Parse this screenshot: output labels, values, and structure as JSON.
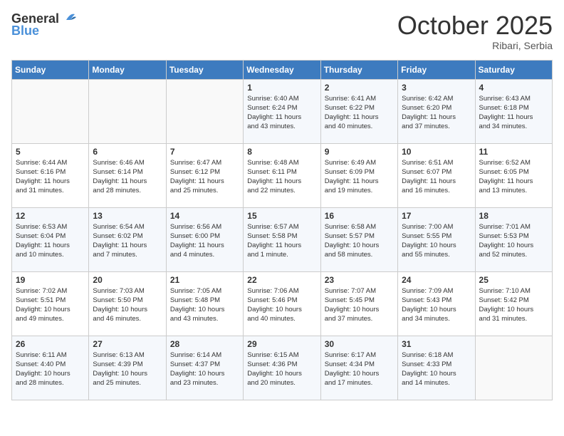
{
  "header": {
    "logo_general": "General",
    "logo_blue": "Blue",
    "month_title": "October 2025",
    "location": "Ribari, Serbia"
  },
  "days_of_week": [
    "Sunday",
    "Monday",
    "Tuesday",
    "Wednesday",
    "Thursday",
    "Friday",
    "Saturday"
  ],
  "weeks": [
    [
      {
        "day": "",
        "info": ""
      },
      {
        "day": "",
        "info": ""
      },
      {
        "day": "",
        "info": ""
      },
      {
        "day": "1",
        "info": "Sunrise: 6:40 AM\nSunset: 6:24 PM\nDaylight: 11 hours\nand 43 minutes."
      },
      {
        "day": "2",
        "info": "Sunrise: 6:41 AM\nSunset: 6:22 PM\nDaylight: 11 hours\nand 40 minutes."
      },
      {
        "day": "3",
        "info": "Sunrise: 6:42 AM\nSunset: 6:20 PM\nDaylight: 11 hours\nand 37 minutes."
      },
      {
        "day": "4",
        "info": "Sunrise: 6:43 AM\nSunset: 6:18 PM\nDaylight: 11 hours\nand 34 minutes."
      }
    ],
    [
      {
        "day": "5",
        "info": "Sunrise: 6:44 AM\nSunset: 6:16 PM\nDaylight: 11 hours\nand 31 minutes."
      },
      {
        "day": "6",
        "info": "Sunrise: 6:46 AM\nSunset: 6:14 PM\nDaylight: 11 hours\nand 28 minutes."
      },
      {
        "day": "7",
        "info": "Sunrise: 6:47 AM\nSunset: 6:12 PM\nDaylight: 11 hours\nand 25 minutes."
      },
      {
        "day": "8",
        "info": "Sunrise: 6:48 AM\nSunset: 6:11 PM\nDaylight: 11 hours\nand 22 minutes."
      },
      {
        "day": "9",
        "info": "Sunrise: 6:49 AM\nSunset: 6:09 PM\nDaylight: 11 hours\nand 19 minutes."
      },
      {
        "day": "10",
        "info": "Sunrise: 6:51 AM\nSunset: 6:07 PM\nDaylight: 11 hours\nand 16 minutes."
      },
      {
        "day": "11",
        "info": "Sunrise: 6:52 AM\nSunset: 6:05 PM\nDaylight: 11 hours\nand 13 minutes."
      }
    ],
    [
      {
        "day": "12",
        "info": "Sunrise: 6:53 AM\nSunset: 6:04 PM\nDaylight: 11 hours\nand 10 minutes."
      },
      {
        "day": "13",
        "info": "Sunrise: 6:54 AM\nSunset: 6:02 PM\nDaylight: 11 hours\nand 7 minutes."
      },
      {
        "day": "14",
        "info": "Sunrise: 6:56 AM\nSunset: 6:00 PM\nDaylight: 11 hours\nand 4 minutes."
      },
      {
        "day": "15",
        "info": "Sunrise: 6:57 AM\nSunset: 5:58 PM\nDaylight: 11 hours\nand 1 minute."
      },
      {
        "day": "16",
        "info": "Sunrise: 6:58 AM\nSunset: 5:57 PM\nDaylight: 10 hours\nand 58 minutes."
      },
      {
        "day": "17",
        "info": "Sunrise: 7:00 AM\nSunset: 5:55 PM\nDaylight: 10 hours\nand 55 minutes."
      },
      {
        "day": "18",
        "info": "Sunrise: 7:01 AM\nSunset: 5:53 PM\nDaylight: 10 hours\nand 52 minutes."
      }
    ],
    [
      {
        "day": "19",
        "info": "Sunrise: 7:02 AM\nSunset: 5:51 PM\nDaylight: 10 hours\nand 49 minutes."
      },
      {
        "day": "20",
        "info": "Sunrise: 7:03 AM\nSunset: 5:50 PM\nDaylight: 10 hours\nand 46 minutes."
      },
      {
        "day": "21",
        "info": "Sunrise: 7:05 AM\nSunset: 5:48 PM\nDaylight: 10 hours\nand 43 minutes."
      },
      {
        "day": "22",
        "info": "Sunrise: 7:06 AM\nSunset: 5:46 PM\nDaylight: 10 hours\nand 40 minutes."
      },
      {
        "day": "23",
        "info": "Sunrise: 7:07 AM\nSunset: 5:45 PM\nDaylight: 10 hours\nand 37 minutes."
      },
      {
        "day": "24",
        "info": "Sunrise: 7:09 AM\nSunset: 5:43 PM\nDaylight: 10 hours\nand 34 minutes."
      },
      {
        "day": "25",
        "info": "Sunrise: 7:10 AM\nSunset: 5:42 PM\nDaylight: 10 hours\nand 31 minutes."
      }
    ],
    [
      {
        "day": "26",
        "info": "Sunrise: 6:11 AM\nSunset: 4:40 PM\nDaylight: 10 hours\nand 28 minutes."
      },
      {
        "day": "27",
        "info": "Sunrise: 6:13 AM\nSunset: 4:39 PM\nDaylight: 10 hours\nand 25 minutes."
      },
      {
        "day": "28",
        "info": "Sunrise: 6:14 AM\nSunset: 4:37 PM\nDaylight: 10 hours\nand 23 minutes."
      },
      {
        "day": "29",
        "info": "Sunrise: 6:15 AM\nSunset: 4:36 PM\nDaylight: 10 hours\nand 20 minutes."
      },
      {
        "day": "30",
        "info": "Sunrise: 6:17 AM\nSunset: 4:34 PM\nDaylight: 10 hours\nand 17 minutes."
      },
      {
        "day": "31",
        "info": "Sunrise: 6:18 AM\nSunset: 4:33 PM\nDaylight: 10 hours\nand 14 minutes."
      },
      {
        "day": "",
        "info": ""
      }
    ]
  ]
}
